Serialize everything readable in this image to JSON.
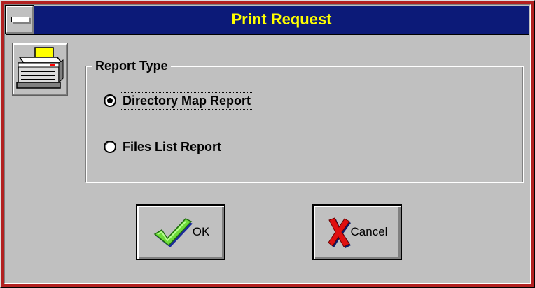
{
  "window": {
    "title": "Print Request"
  },
  "report_type": {
    "legend": "Report Type",
    "options": [
      {
        "label": "Directory Map Report",
        "selected": true
      },
      {
        "label": "Files List Report",
        "selected": false
      }
    ]
  },
  "buttons": {
    "ok_label": "OK",
    "cancel_label": "Cancel"
  },
  "icons": {
    "system_menu": "system-menu-icon",
    "printer": "printer-icon",
    "ok": "checkmark-icon",
    "cancel": "x-icon"
  },
  "colors": {
    "titlebar": "#0c1a78",
    "title_text": "#ffff00",
    "dialog_bg": "#c0c0c0",
    "frame": "#b22020"
  }
}
